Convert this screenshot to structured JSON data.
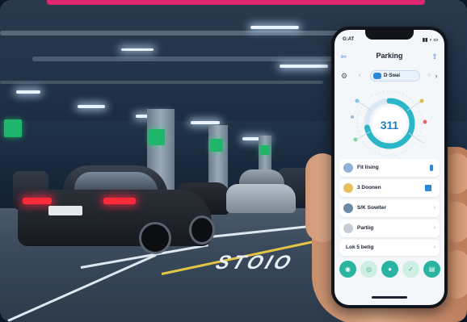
{
  "phone": {
    "status": {
      "time": "G:AT",
      "icons": "▮▮ ◖ ▭"
    },
    "header": {
      "title": "Parking"
    },
    "nav": {
      "selector_label": "D·Swai"
    },
    "gauge": {
      "value": "311",
      "fill_fraction": 0.72
    },
    "list": [
      {
        "label": "Fit lising",
        "trail_type": "toggle"
      },
      {
        "label": "3 Doonen",
        "trail_type": "bars"
      },
      {
        "label": "S/K Sowiter",
        "trail_type": "chevron"
      },
      {
        "label": "Partiig",
        "trail_type": "chevron"
      }
    ],
    "bottom_item": {
      "label": "Lok 5 betig"
    },
    "tabs": [
      "user-icon",
      "info-icon",
      "person-icon",
      "check-icon",
      "car-icon"
    ]
  },
  "scene": {
    "floor_text": "STOIO",
    "accent_color": "#e0266e",
    "teal": "#2ab3a0",
    "blue": "#2a88d8"
  }
}
